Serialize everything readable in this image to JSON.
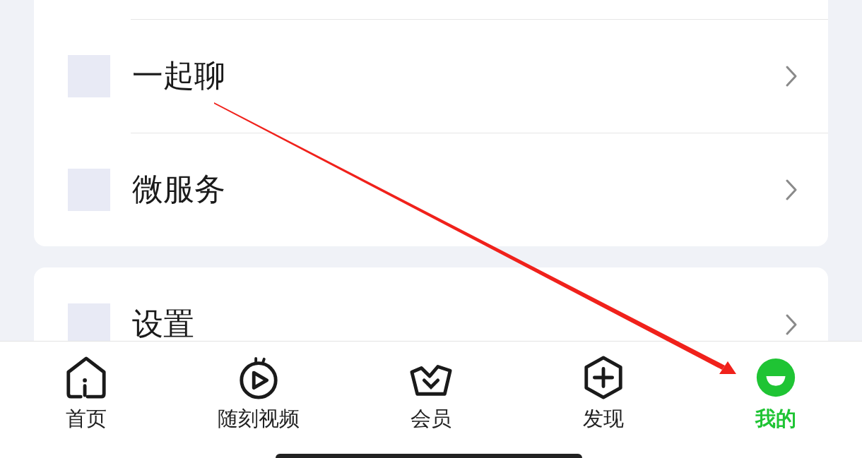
{
  "cards": [
    {
      "rows": [
        {
          "label": "一起聊"
        },
        {
          "label": "微服务"
        }
      ]
    },
    {
      "rows": [
        {
          "label": "设置"
        }
      ]
    }
  ],
  "tabs": [
    {
      "label": "首页",
      "kind": "home",
      "selected": false
    },
    {
      "label": "随刻视频",
      "kind": "video",
      "selected": false
    },
    {
      "label": "会员",
      "kind": "vip",
      "selected": false
    },
    {
      "label": "发现",
      "kind": "discover",
      "selected": false
    },
    {
      "label": "我的",
      "kind": "me",
      "selected": true
    }
  ],
  "annotation": {
    "kind": "arrow"
  }
}
